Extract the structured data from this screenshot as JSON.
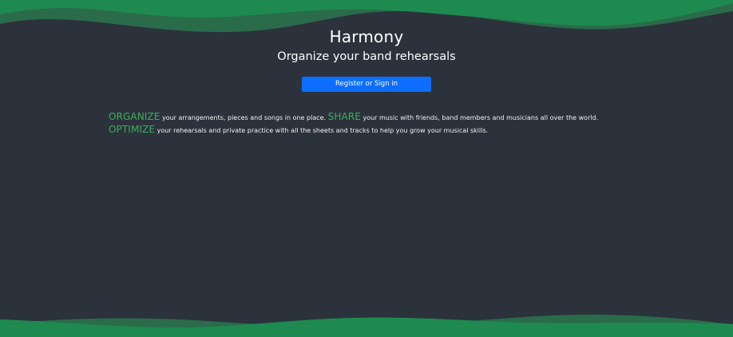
{
  "colors": {
    "background": "#2b323c",
    "wave_light": "#2a6b4a",
    "wave_dark": "#1e8a50",
    "accent_keyword": "#3fae5a",
    "button": "#0d6efd"
  },
  "header": {
    "title": "Harmony",
    "subtitle": "Organize your band rehearsals"
  },
  "cta": {
    "label": "Register or Sign in"
  },
  "intro": {
    "kw1": "ORGANIZE",
    "text1": " your arrangements, pieces and songs in one place. ",
    "kw2": "SHARE",
    "text2": " your music with friends, band members and musicians all over the world. ",
    "kw3": "OPTIMIZE",
    "text3": " your rehearsals and private practice with all the sheets and tracks to help you grow your musical skills."
  }
}
